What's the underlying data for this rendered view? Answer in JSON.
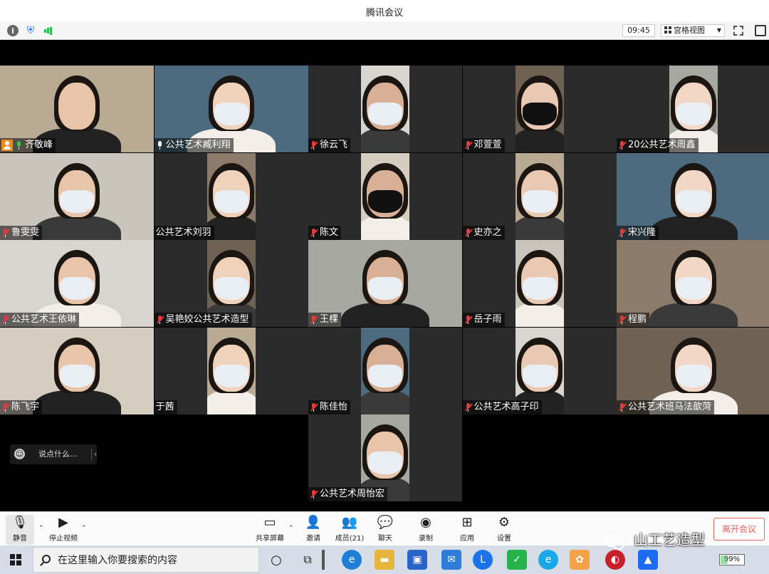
{
  "window": {
    "title": "腾讯会议"
  },
  "topbar": {
    "time": "09:45",
    "view_label": "宫格视图"
  },
  "participants": [
    {
      "name": "齐敬峰",
      "role": "host",
      "mic": "on"
    },
    {
      "name": "公共艺术臧利翔",
      "mic": "on"
    },
    {
      "name": "徐云飞",
      "mic": "muted"
    },
    {
      "name": "邓萱萱",
      "mic": "muted"
    },
    {
      "name": "20公共艺术周鑫",
      "mic": "muted"
    },
    {
      "name": "鲁雯雯",
      "mic": "muted"
    },
    {
      "name": "公共艺术刘羽",
      "mic": "none"
    },
    {
      "name": "陈文",
      "mic": "muted"
    },
    {
      "name": "史亦之",
      "mic": "muted"
    },
    {
      "name": "宋兴隆",
      "mic": "muted"
    },
    {
      "name": "公共艺术王依琳",
      "mic": "muted"
    },
    {
      "name": "吴艳姣公共艺术造型",
      "mic": "muted"
    },
    {
      "name": "王棵",
      "mic": "muted"
    },
    {
      "name": "岳子雨",
      "mic": "muted"
    },
    {
      "name": "程鹏",
      "mic": "muted"
    },
    {
      "name": "陈飞宇",
      "mic": "muted"
    },
    {
      "name": "于茜",
      "mic": "none"
    },
    {
      "name": "陈佳怡",
      "mic": "muted"
    },
    {
      "name": "公共艺术高子印",
      "mic": "muted"
    },
    {
      "name": "公共艺术班马法歆菏",
      "mic": "muted"
    },
    {
      "name": "公共艺术周怡宏",
      "mic": "muted"
    }
  ],
  "chat": {
    "placeholder": "说点什么..."
  },
  "controls": {
    "mute": "静音",
    "stop_video": "停止视频",
    "share_screen": "共享屏幕",
    "invite": "邀请",
    "members": "成员(21)",
    "chat": "聊天",
    "record": "录制",
    "apps": "应用",
    "settings": "设置",
    "leave": "离开会议"
  },
  "watermark": {
    "text": "山工艺造型"
  },
  "taskbar": {
    "search_placeholder": "在这里输入你要搜索的内容",
    "battery": "99%"
  }
}
